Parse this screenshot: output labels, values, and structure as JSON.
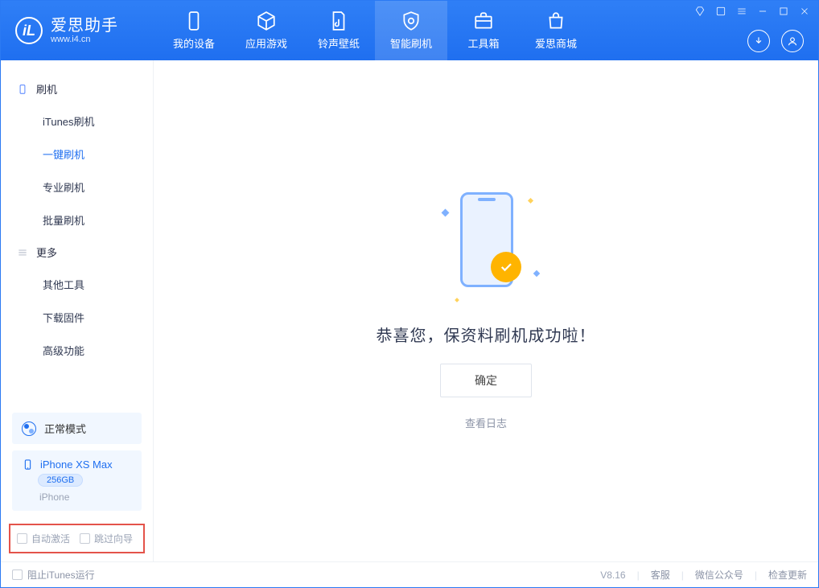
{
  "app": {
    "name_cn": "爱思助手",
    "name_en": "www.i4.cn"
  },
  "nav": [
    {
      "label": "我的设备"
    },
    {
      "label": "应用游戏"
    },
    {
      "label": "铃声壁纸"
    },
    {
      "label": "智能刷机"
    },
    {
      "label": "工具箱"
    },
    {
      "label": "爱思商城"
    }
  ],
  "sidebar": {
    "group1_title": "刷机",
    "group1_items": [
      {
        "label": "iTunes刷机"
      },
      {
        "label": "一键刷机"
      },
      {
        "label": "专业刷机"
      },
      {
        "label": "批量刷机"
      }
    ],
    "group2_title": "更多",
    "group2_items": [
      {
        "label": "其他工具"
      },
      {
        "label": "下载固件"
      },
      {
        "label": "高级功能"
      }
    ],
    "mode_label": "正常模式",
    "device_name": "iPhone XS Max",
    "device_storage": "256GB",
    "device_sub": "iPhone",
    "check_auto_activate": "自动激活",
    "check_skip_guide": "跳过向导"
  },
  "main": {
    "success_title": "恭喜您，保资料刷机成功啦！",
    "confirm_label": "确定",
    "view_log_label": "查看日志"
  },
  "statusbar": {
    "block_itunes": "阻止iTunes运行",
    "version": "V8.16",
    "support": "客服",
    "wechat": "微信公众号",
    "check_update": "检查更新"
  }
}
